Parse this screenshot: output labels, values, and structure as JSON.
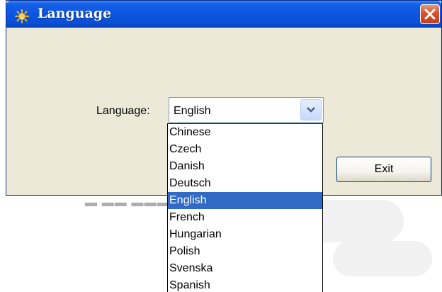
{
  "window": {
    "title": "Language"
  },
  "form": {
    "language_label": "Language:",
    "selected_value": "English"
  },
  "buttons": {
    "exit_label": "Exit"
  },
  "dropdown": {
    "options": [
      "Chinese",
      "Czech",
      "Danish",
      "Deutsch",
      "English",
      "French",
      "Hungarian",
      "Polish",
      "Svenska",
      "Spanish"
    ],
    "selected_index": 4
  },
  "colors": {
    "titlebar": "#0b55e0",
    "selection": "#316ac5",
    "window_body": "#ece9d8",
    "close_button": "#d8502a"
  },
  "icons": {
    "app": "sun-icon",
    "close": "close-icon",
    "dropdown": "chevron-down-icon"
  }
}
